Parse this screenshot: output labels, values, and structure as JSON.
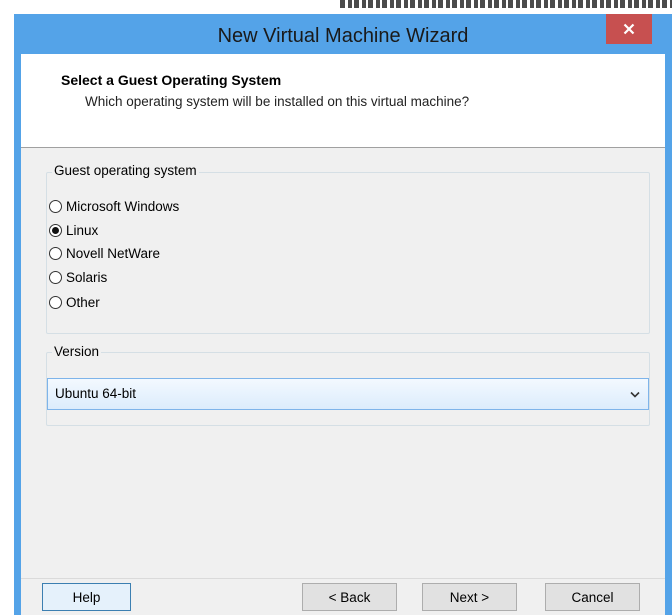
{
  "window": {
    "title": "New Virtual Machine Wizard"
  },
  "header": {
    "title": "Select a Guest Operating System",
    "subtitle": "Which operating system will be installed on this virtual machine?"
  },
  "guest_os": {
    "group_label": "Guest operating system",
    "options": [
      {
        "label": "Microsoft Windows",
        "selected": false
      },
      {
        "label": "Linux",
        "selected": true
      },
      {
        "label": "Novell NetWare",
        "selected": false
      },
      {
        "label": "Solaris",
        "selected": false
      },
      {
        "label": "Other",
        "selected": false
      }
    ]
  },
  "version": {
    "group_label": "Version",
    "selected": "Ubuntu 64-bit"
  },
  "buttons": {
    "help": "Help",
    "back": "< Back",
    "next": "Next >",
    "cancel": "Cancel"
  },
  "colors": {
    "titlebar": "#54a3e8",
    "close_button": "#c75050",
    "dialog_background": "#f0f0f0"
  },
  "icons": {
    "close": "close-icon",
    "dropdown": "chevron-down-icon"
  }
}
